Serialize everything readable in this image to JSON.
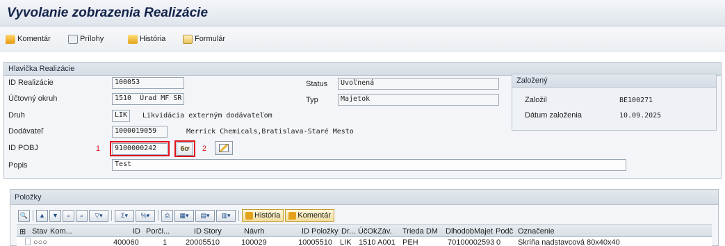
{
  "window": {
    "title": "Vyvolanie zobrazenia Realizácie"
  },
  "toolbar": {
    "items": [
      {
        "label": "Komentár",
        "icon": "comment-icon"
      },
      {
        "label": "Prílohy",
        "icon": "attachment-icon"
      },
      {
        "label": "História",
        "icon": "history-icon"
      },
      {
        "label": "Formulár",
        "icon": "form-icon"
      }
    ]
  },
  "header": {
    "title": "Hlavička Realizácie",
    "id_realizacie": {
      "label": "ID Realizácie",
      "value": "100053"
    },
    "uctovny_okruh": {
      "label": "Účtovný okruh",
      "code": "1510",
      "text": "Úrad MF SR"
    },
    "druh": {
      "label": "Druh",
      "code": "LIK",
      "text": "Likvidácia externým dodávateľom"
    },
    "dodavatel": {
      "label": "Dodávateľ",
      "code": "1000019059",
      "text": "Merrick Chemicals,Bratislava-Staré Mesto"
    },
    "id_pobj": {
      "label": "ID POBJ",
      "value": "9100000242",
      "marker1": "1",
      "marker2": "2"
    },
    "popis": {
      "label": "Popis",
      "value": "Test"
    },
    "status": {
      "label": "Status",
      "value": "Uvoľnená"
    },
    "typ": {
      "label": "Typ",
      "value": "Majetok"
    }
  },
  "zalozeny": {
    "title": "Založený",
    "zalozil": {
      "label": "Založil",
      "value": "BE100271"
    },
    "datum": {
      "label": "Dátum založenia",
      "value": "10.09.2025"
    }
  },
  "items": {
    "title": "Položky",
    "toolbar_history": "História",
    "toolbar_comment": "Komentár",
    "columns": [
      "Stav",
      "Kom...",
      "ID",
      "Porči...",
      "ID Story",
      "Návrh",
      "ID Položky",
      "Dr...",
      "ÚčOk",
      "Záv.",
      "Trieda DM",
      "DlhodobMajet",
      "Podč",
      "Označenie"
    ],
    "rows": [
      {
        "stav": "○○○",
        "id": "400060",
        "porc": "1",
        "story": "20005510",
        "navrh": "100029",
        "polozky": "10005510",
        "dr": "LIK",
        "ucok": "1510",
        "zav": "A001",
        "trieda": "PEH",
        "dlhodob": "70100002593",
        "podc": "0",
        "oznacenie": "Skriňa nadstavcová 80x40x40"
      }
    ]
  },
  "colors": {
    "accent_red": "#e0121b",
    "title_blue": "#13234a"
  }
}
